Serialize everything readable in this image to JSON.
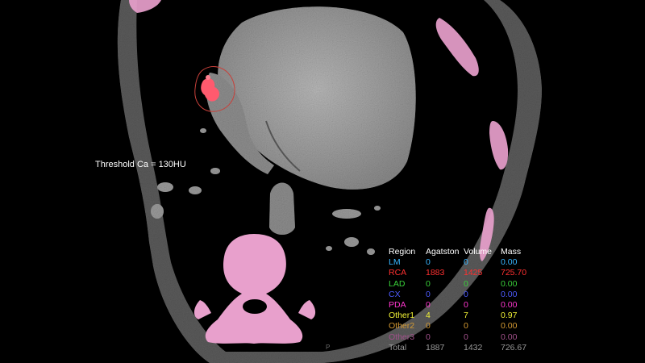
{
  "image": {
    "modality": "CT",
    "view": "axial-chest",
    "overlay_color": "#e8a0cc",
    "calcium_highlight_color": "#ff5a6e"
  },
  "annotations": {
    "threshold_label": "Threshold Ca = 130HU",
    "orientation_marker": "P"
  },
  "score_table": {
    "headers": [
      "Region",
      "Agatston",
      "Volume",
      "Mass"
    ],
    "rows": [
      {
        "region": "LM",
        "agatston": "0",
        "volume": "0",
        "mass": "0.00",
        "color": "#37b5ff"
      },
      {
        "region": "RCA",
        "agatston": "1883",
        "volume": "1425",
        "mass": "725.70",
        "color": "#ff3030"
      },
      {
        "region": "LAD",
        "agatston": "0",
        "volume": "0",
        "mass": "0.00",
        "color": "#39d039"
      },
      {
        "region": "CX",
        "agatston": "0",
        "volume": "0",
        "mass": "0.00",
        "color": "#4d5bff"
      },
      {
        "region": "PDA",
        "agatston": "0",
        "volume": "0",
        "mass": "0.00",
        "color": "#ff37cf"
      },
      {
        "region": "Other1",
        "agatston": "4",
        "volume": "7",
        "mass": "0.97",
        "color": "#f2f235"
      },
      {
        "region": "Other2",
        "agatston": "0",
        "volume": "0",
        "mass": "0.00",
        "color": "#d59a32"
      },
      {
        "region": "Other3",
        "agatston": "0",
        "volume": "0",
        "mass": "0.00",
        "color": "#a0508a"
      },
      {
        "region": "Total",
        "agatston": "1887",
        "volume": "1432",
        "mass": "726.67",
        "color": "#9a9a9a"
      }
    ]
  }
}
